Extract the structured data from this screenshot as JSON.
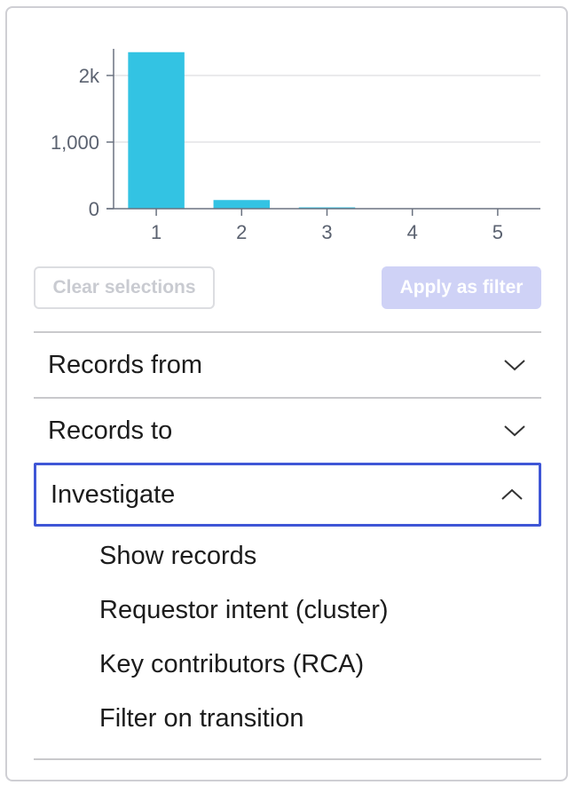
{
  "chart_data": {
    "type": "bar",
    "categories": [
      "1",
      "2",
      "3",
      "4",
      "5"
    ],
    "values": [
      2350,
      130,
      8,
      0,
      0
    ],
    "ylim": [
      0,
      2400
    ],
    "yticks": [
      {
        "value": 0,
        "label": "0"
      },
      {
        "value": 1000,
        "label": "1,000"
      },
      {
        "value": 2000,
        "label": "2k"
      }
    ],
    "bar_color": "#33c3e3",
    "grid": true
  },
  "actions": {
    "clear_label": "Clear selections",
    "apply_label": "Apply as filter"
  },
  "sections": {
    "records_from": "Records from",
    "records_to": "Records to",
    "investigate": "Investigate"
  },
  "investigate_items": [
    "Show records",
    "Requestor intent (cluster)",
    "Key contributors (RCA)",
    "Filter on transition"
  ],
  "colors": {
    "focus_border": "#3f56d6",
    "apply_bg": "#cfd2f6"
  }
}
